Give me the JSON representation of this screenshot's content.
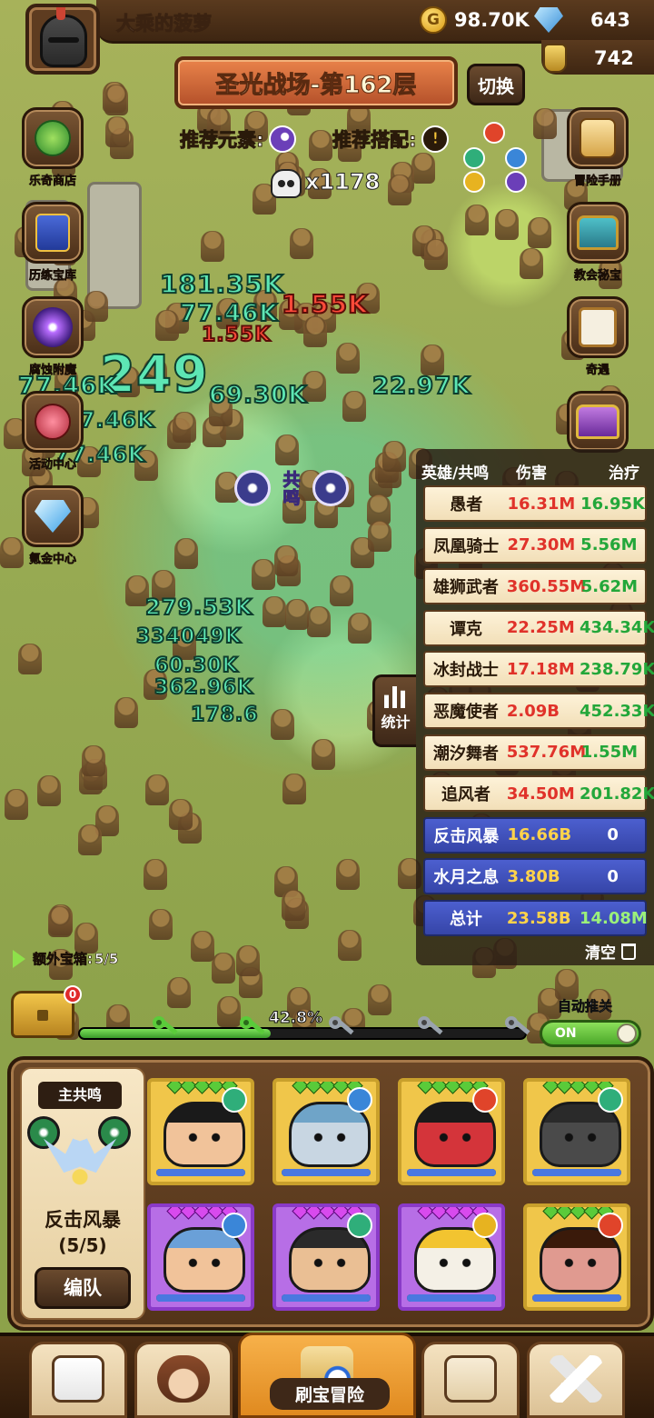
{
  "player": {
    "name": "大乘的菠萝"
  },
  "resources": {
    "gold": "98.70K",
    "gems": "643",
    "potion": "742"
  },
  "stage": {
    "title": "圣光战场-第162层",
    "switch_label": "切换"
  },
  "recommend": {
    "element_label": "推荐元素:",
    "combo_label": "推荐搭配:",
    "combo_icon": "!"
  },
  "kills": {
    "count": "x1178"
  },
  "left_menu": [
    {
      "label": "乐奇商店",
      "icon": "clover-icon"
    },
    {
      "label": "历练宝库",
      "icon": "book-icon"
    },
    {
      "label": "腐蚀附魔",
      "icon": "portal-icon"
    },
    {
      "label": "活动中心",
      "icon": "flower-icon"
    },
    {
      "label": "氪金中心",
      "icon": "diamond-icon"
    }
  ],
  "right_menu": [
    {
      "label": "冒险手册",
      "icon": "scroll-icon"
    },
    {
      "label": "教会秘宝",
      "icon": "chest-icon"
    },
    {
      "label": "奇遇",
      "icon": "board-icon"
    }
  ],
  "damage_numbers": [
    "181.35K",
    "77.46K",
    "1.55K",
    "1.55K",
    "249",
    "77.46K",
    "69.30K",
    "22.97K",
    "77.46K",
    "77.46K",
    "279.53K",
    "334049K",
    "60.30K",
    "362.96K",
    "178.6"
  ],
  "resonance": {
    "label_top": "共",
    "label_bottom": "鸣"
  },
  "stats": {
    "headers": {
      "name": "英雄/共鸣",
      "damage": "伤害",
      "heal": "治疗"
    },
    "rows": [
      {
        "name": "愚者",
        "damage": "16.31M",
        "heal": "16.95K",
        "kind": "hero"
      },
      {
        "name": "凤凰骑士",
        "damage": "27.30M",
        "heal": "5.56M",
        "kind": "hero"
      },
      {
        "name": "雄狮武者",
        "damage": "360.55M",
        "heal": "5.62M",
        "kind": "hero"
      },
      {
        "name": "谭克",
        "damage": "22.25M",
        "heal": "434.34K",
        "kind": "hero"
      },
      {
        "name": "冰封战士",
        "damage": "17.18M",
        "heal": "238.79K",
        "kind": "hero"
      },
      {
        "name": "恶魔使者",
        "damage": "2.09B",
        "heal": "452.33K",
        "kind": "hero"
      },
      {
        "name": "潮汐舞者",
        "damage": "537.76M",
        "heal": "1.55M",
        "kind": "hero"
      },
      {
        "name": "追风者",
        "damage": "34.50M",
        "heal": "201.82K",
        "kind": "hero"
      },
      {
        "name": "反击风暴",
        "damage": "16.66B",
        "heal": "0",
        "kind": "resonance"
      },
      {
        "name": "水月之息",
        "damage": "3.80B",
        "heal": "0",
        "kind": "resonance"
      },
      {
        "name": "总计",
        "damage": "23.58B",
        "heal": "14.08M",
        "kind": "total"
      }
    ],
    "clear_label": "清空",
    "tab_label": "统计"
  },
  "extra_chest": {
    "label": "额外宝箱:",
    "value": "5/5"
  },
  "progress": {
    "percent_label": "42.8%",
    "fraction": 0.428,
    "chest_badge": "0",
    "auto_push_label": "自动推关",
    "toggle_label": "ON"
  },
  "team": {
    "main_resonance_label": "主共鸣",
    "resonance_name": "反击风暴",
    "resonance_count": "(5/5)",
    "formation_label": "编队"
  },
  "heroes": [
    {
      "frame": "gold",
      "element": "wind",
      "skin": "#f1c39a",
      "hair": "#1a1a1a"
    },
    {
      "frame": "gold",
      "element": "water",
      "skin": "#c8d6e2",
      "hair": "#6fa4c8"
    },
    {
      "frame": "gold",
      "element": "fire",
      "skin": "#d4343a",
      "hair": "#1a1a1a"
    },
    {
      "frame": "gold",
      "element": "wind",
      "skin": "#4a4a4a",
      "hair": "#2a2a2a"
    },
    {
      "frame": "purple",
      "element": "water",
      "skin": "#f1c39a",
      "hair": "#6aa0d8"
    },
    {
      "frame": "purple",
      "element": "wind",
      "skin": "#eabf94",
      "hair": "#2a2a2a"
    },
    {
      "frame": "purple",
      "element": "light",
      "skin": "#f4f0e6",
      "hair": "#f2c430"
    },
    {
      "frame": "gold",
      "element": "fire",
      "skin": "#e09a90",
      "hair": "#3a1a0a"
    }
  ],
  "nav": {
    "active_label": "刷宝冒险"
  },
  "colors": {
    "wind": "#2fae7a",
    "water": "#3a86d8",
    "fire": "#e0442a",
    "light": "#e7b320",
    "dark": "#6b3fb8"
  }
}
